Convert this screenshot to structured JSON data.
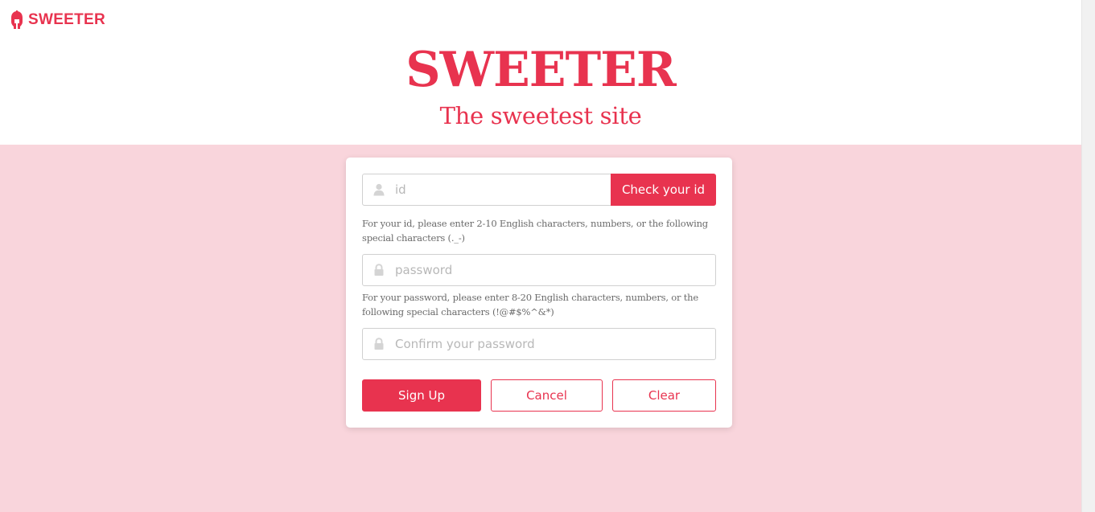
{
  "colors": {
    "accent": "#e8334f",
    "pink_background": "#f9d5dc",
    "icon_gray": "#d4d4d4"
  },
  "navbar": {
    "brand_icon": "spartan-helmet-icon",
    "brand_label": "SWEETER"
  },
  "hero": {
    "title": "SWEETER",
    "subtitle": "The sweetest site"
  },
  "signup_form": {
    "id_field": {
      "icon": "user-icon",
      "placeholder": "id",
      "value": ""
    },
    "check_id_button": "Check your id",
    "id_hint": "For your id, please enter 2-10 English characters, numbers, or the following special characters (._-)",
    "password_field": {
      "icon": "lock-icon",
      "placeholder": "password",
      "value": ""
    },
    "password_hint": "For your password, please enter 8-20 English characters, numbers, or the following special characters (!@#$%^&*)",
    "confirm_field": {
      "icon": "lock-icon",
      "placeholder": "Confirm your password",
      "value": ""
    },
    "buttons": {
      "sign_up": "Sign Up",
      "cancel": "Cancel",
      "clear": "Clear"
    }
  }
}
